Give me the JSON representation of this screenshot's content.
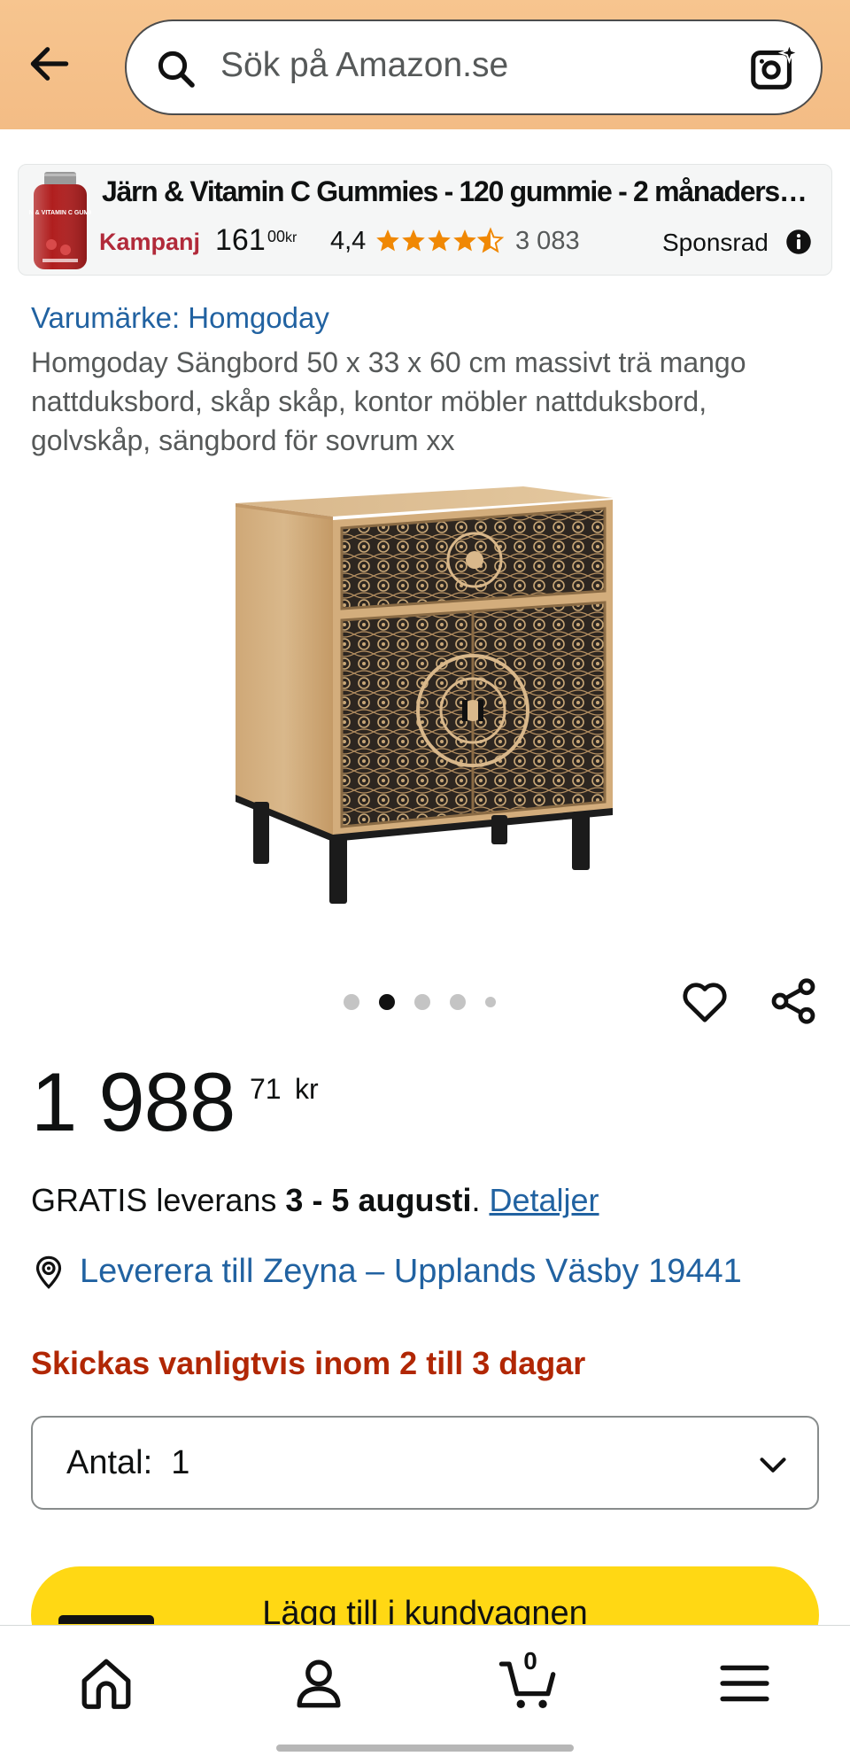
{
  "header": {
    "search_placeholder": "Sök på Amazon.se",
    "background_color": "#f3bc85"
  },
  "sponsored_ad": {
    "title": "Järn & Vitamin C Gummies - 120 gummie - 2 månaders…",
    "promo_label": "Kampanj",
    "price_whole": "161",
    "price_fraction": "00",
    "currency": "kr",
    "rating": "4,4",
    "rating_value": 4.4,
    "review_count": "3 083",
    "sponsored_label": "Sponsrad",
    "thumbnail_text": "JÄRN & VITAMIN C GUMMIES"
  },
  "product": {
    "brand_link": "Varumärke: Homgoday",
    "title": "Homgoday Sängbord 50 x 33 x 60 cm massivt trä mango nattduksbord, skåp skåp, kontor möbler nattduksbord, golvskåp, sängbord för sovrum xx",
    "image_count": 5,
    "active_image_index": 1
  },
  "price": {
    "whole": "1 988",
    "fraction": "71",
    "currency": "kr"
  },
  "delivery": {
    "prefix": "GRATIS leverans ",
    "dates": "3 - 5 augusti",
    "suffix": ". ",
    "details_link": "Detaljer"
  },
  "location": {
    "link_text": "Leverera till Zeyna – Upplands Väsby 19441"
  },
  "availability": {
    "text": "Skickas vanligtvis inom 2 till 3 dagar",
    "color": "#b12704"
  },
  "quantity": {
    "label": "Antal:  1"
  },
  "add_to_cart": {
    "label": "Lägg till i kundvagnen",
    "color": "#ffd814"
  },
  "bottom_nav": {
    "items": [
      "home-icon",
      "account-icon",
      "cart-icon",
      "menu-icon"
    ],
    "cart_count": "0"
  }
}
